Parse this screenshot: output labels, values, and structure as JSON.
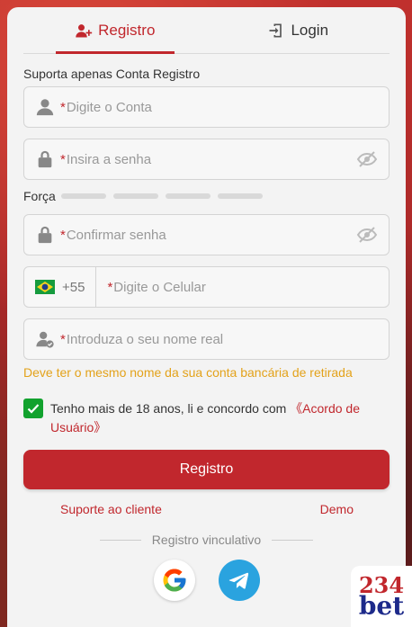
{
  "tabs": [
    {
      "label": "Registro",
      "active": true,
      "icon": "user-plus-icon"
    },
    {
      "label": "Login",
      "active": false,
      "icon": "login-door-icon"
    }
  ],
  "form": {
    "support_note": "Suporta apenas Conta Registro",
    "required_mark": "*",
    "account_placeholder": "Digite o Conta",
    "password_placeholder": "Insira a senha",
    "strength_label": "Força",
    "confirm_placeholder": "Confirmar senha",
    "phone_prefix": "+55",
    "phone_placeholder": "Digite o Celular",
    "name_placeholder": "Introduza o seu nome real",
    "name_note": "Deve ter o mesmo nome da sua conta bancária de retirada",
    "agree_text": "Tenho mais de 18 anos, li e concordo com",
    "agree_link": "《Acordo de Usuário》",
    "agree_checked": true,
    "submit_label": "Registro"
  },
  "links": {
    "support": "Suporte ao cliente",
    "demo": "Demo"
  },
  "social": {
    "divider_text": "Registro vinculativo",
    "providers": [
      "google",
      "telegram"
    ]
  },
  "brand": {
    "logo_num": "234",
    "logo_word": "bet"
  },
  "colors": {
    "accent": "#c1272d",
    "warning": "#e3a21a",
    "check": "#12a22e",
    "telegram": "#2aa3df"
  }
}
